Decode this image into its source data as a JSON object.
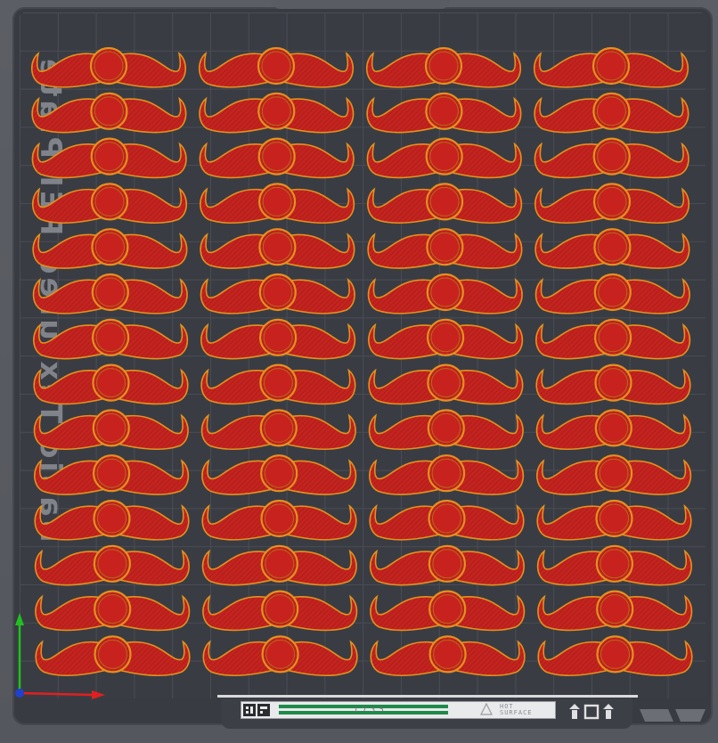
{
  "plate": {
    "side_label": "Basic Textured PEI Plate",
    "rows": 14,
    "columns": 4,
    "part_name": "mustache",
    "part_colors": {
      "fill": "#c4231f",
      "outline": "#e2921f",
      "hatch": "#a31c18"
    },
    "grid_color": "#4a4d55",
    "plate_color": "#3a3c43"
  },
  "sticker": {
    "code": "1 7 3 5",
    "hot_warning": [
      "HOT",
      "SURFACE"
    ],
    "accent": "#1e8a4a"
  },
  "axes": {
    "x_color": "#e02020",
    "y_color": "#20c020",
    "origin_color": "#2040d0"
  },
  "icons": [
    "warning-triangle-icon",
    "stack-up-icon",
    "square-icon",
    "stack-down-icon",
    "qr-code-icon"
  ]
}
